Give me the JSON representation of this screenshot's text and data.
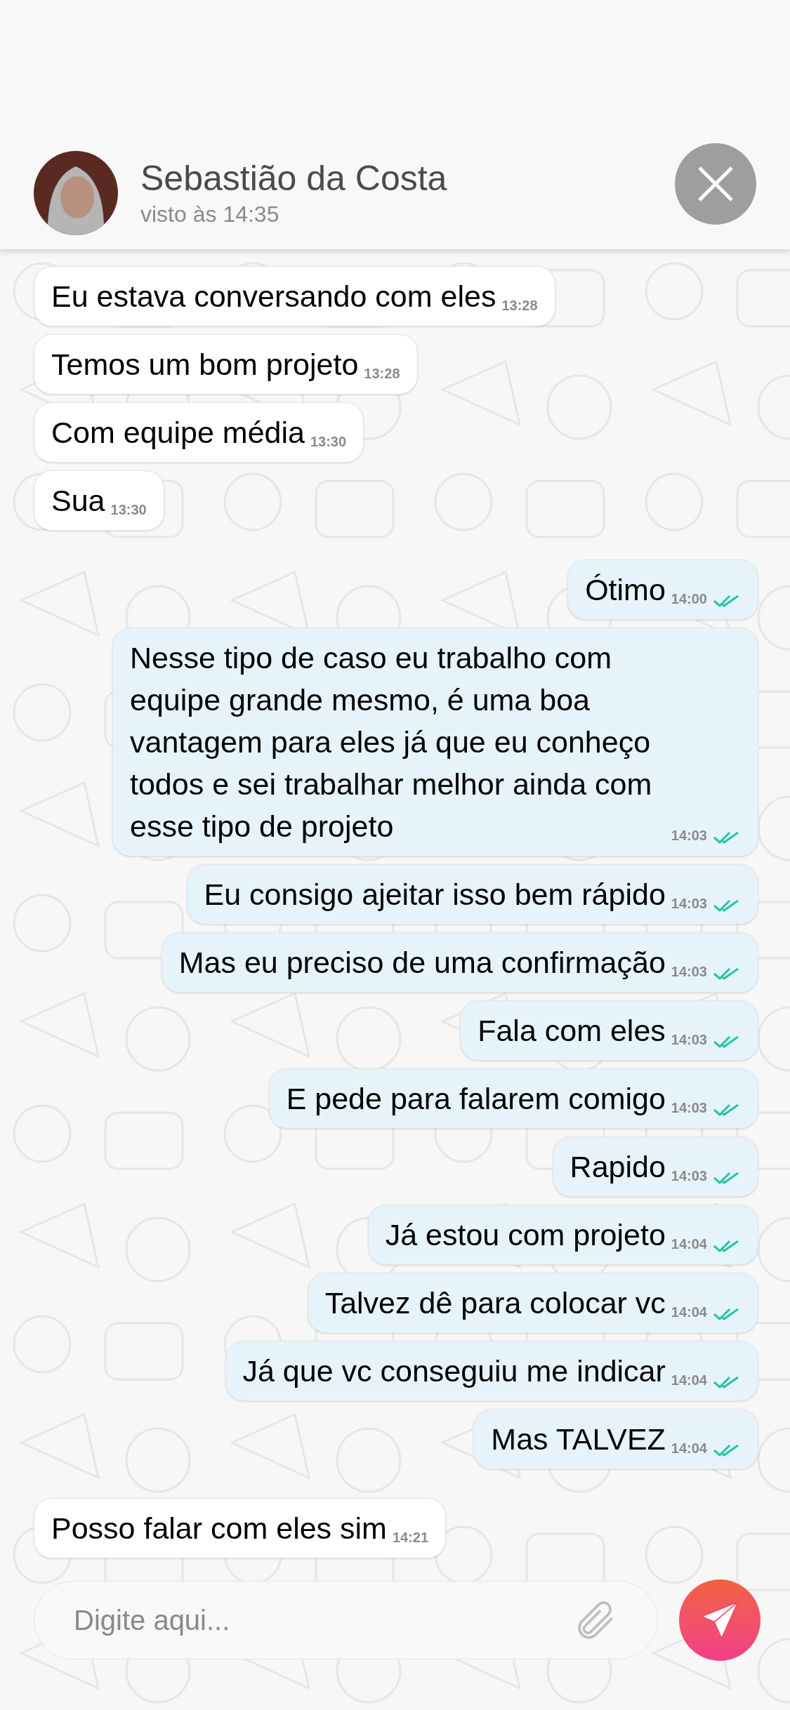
{
  "contact": {
    "name": "Sebastião da Costa",
    "status": "visto às 14:35"
  },
  "messages": [
    {
      "kind": "incoming",
      "text": "Eu estava conversando com eles",
      "time": "13:28"
    },
    {
      "kind": "incoming",
      "text": "Temos um bom projeto",
      "time": "13:28"
    },
    {
      "kind": "incoming",
      "text": "Com equipe média",
      "time": "13:30"
    },
    {
      "kind": "incoming",
      "text": "Sua",
      "time": "13:30"
    },
    {
      "kind": "outgoing",
      "text": "Ótimo",
      "time": "14:00",
      "read": true
    },
    {
      "kind": "outgoing",
      "text": "Nesse tipo de caso eu trabalho com equipe grande mesmo, é uma boa vantagem para eles já que eu conheço todos e sei trabalhar melhor ainda com esse tipo de projeto",
      "time": "14:03",
      "read": true
    },
    {
      "kind": "outgoing",
      "text": "Eu consigo ajeitar isso bem rápido",
      "time": "14:03",
      "read": true
    },
    {
      "kind": "outgoing",
      "text": "Mas eu preciso de uma confirmação",
      "time": "14:03",
      "read": true
    },
    {
      "kind": "outgoing",
      "text": "Fala com eles",
      "time": "14:03",
      "read": true
    },
    {
      "kind": "outgoing",
      "text": "E pede para falarem comigo",
      "time": "14:03",
      "read": true
    },
    {
      "kind": "outgoing",
      "text": "Rapido",
      "time": "14:03",
      "read": true
    },
    {
      "kind": "outgoing",
      "text": "Já estou com projeto",
      "time": "14:04",
      "read": true
    },
    {
      "kind": "outgoing",
      "text": "Talvez dê para colocar vc",
      "time": "14:04",
      "read": true
    },
    {
      "kind": "outgoing",
      "text": "Já que vc conseguiu me indicar",
      "time": "14:04",
      "read": true
    },
    {
      "kind": "outgoing",
      "text": "Mas TALVEZ",
      "time": "14:04",
      "read": true
    },
    {
      "kind": "incoming",
      "text": "Posso falar com eles sim",
      "time": "14:21"
    }
  ],
  "composer": {
    "placeholder": "Digite aqui..."
  }
}
